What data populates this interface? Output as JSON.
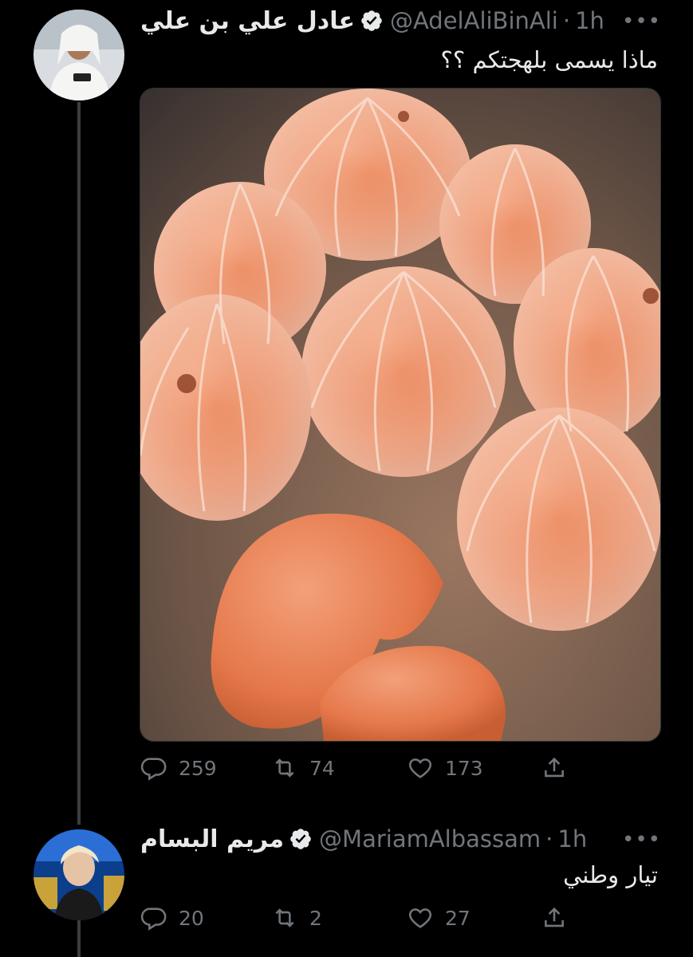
{
  "tweets": [
    {
      "author_name": "عادل علي بن علي",
      "handle": "@AdelAliBinAli",
      "time": "1h",
      "text": "ماذا يسمى بلهجتكم ؟؟",
      "stats": {
        "replies": "259",
        "retweets": "74",
        "likes": "173"
      }
    },
    {
      "author_name": "مريم البسام",
      "handle": "@MariamAlbassam",
      "time": "1h",
      "text": "تيار وطني",
      "stats": {
        "replies": "20",
        "retweets": "2",
        "likes": "27"
      }
    }
  ],
  "separator": "·",
  "more_glyph": "•••",
  "colors": {
    "background": "#000000",
    "text": "#e7e9ea",
    "muted": "#71767b",
    "verified_badge": "#e7e9ea",
    "peel_orange": "#e8865a"
  },
  "media": {
    "description_icon": "photo-peeled-mandarins"
  }
}
